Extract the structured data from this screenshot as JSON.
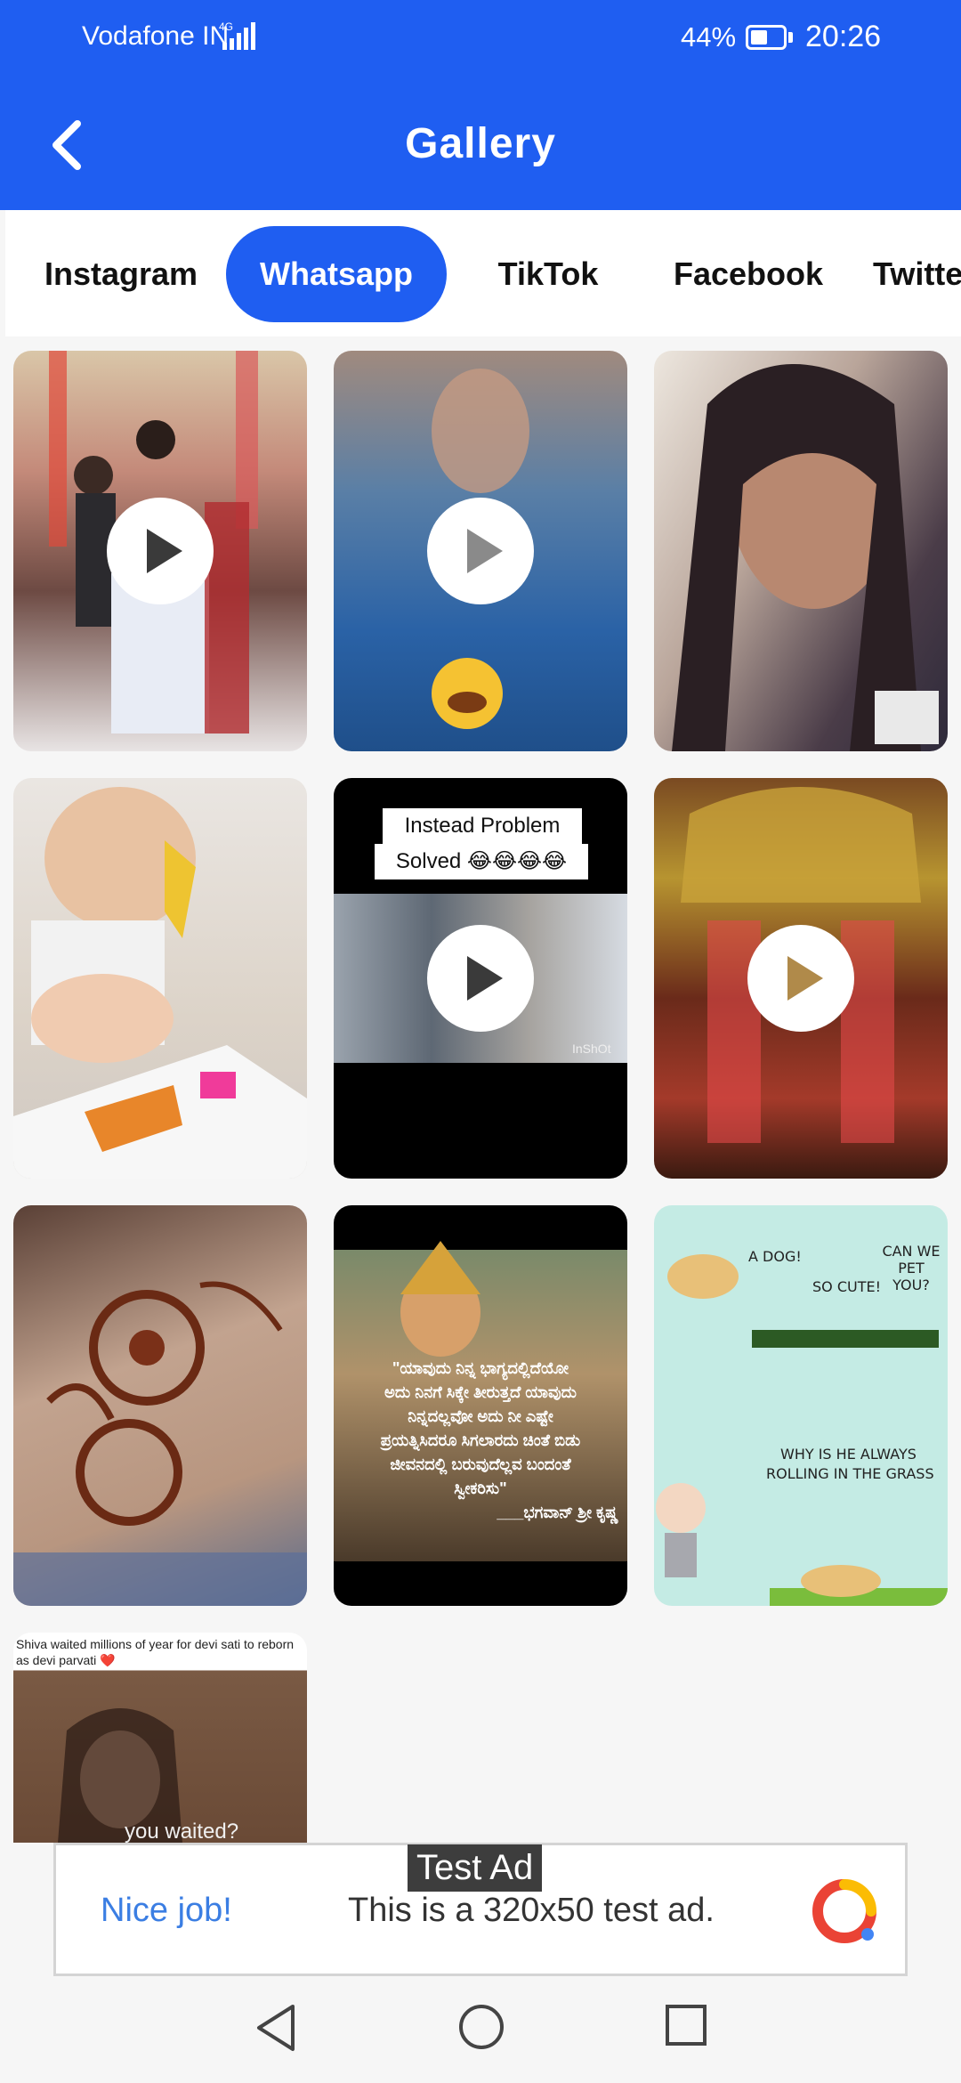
{
  "status_bar": {
    "carrier": "Vodafone IN",
    "network": "4G",
    "battery": "44%",
    "time": "20:26"
  },
  "app_bar": {
    "title": "Gallery",
    "back_icon": "chevron-left-icon"
  },
  "tabs": [
    {
      "label": "Instagram",
      "active": false
    },
    {
      "label": "Whatsapp",
      "active": true
    },
    {
      "label": "TikTok",
      "active": false
    },
    {
      "label": "Facebook",
      "active": false
    },
    {
      "label": "Twitter",
      "active": false
    }
  ],
  "gallery": {
    "items": [
      {
        "kind": "video"
      },
      {
        "kind": "video"
      },
      {
        "kind": "image"
      },
      {
        "kind": "image"
      },
      {
        "kind": "video",
        "caption_line1": "Instead Problem",
        "caption_line2": "Solved 😂😂😂😂",
        "watermark": "InShOt"
      },
      {
        "kind": "video"
      },
      {
        "kind": "image"
      },
      {
        "kind": "image",
        "caption_lines": [
          "\"ಯಾವುದು ನಿನ್ನ ಭಾಗ್ಯದಲ್ಲಿದೆಯೋ",
          "ಅದು ನಿನಗೆ ಸಿಕ್ಕೇ ತೀರುತ್ತದೆ ಯಾವುದು",
          "ನಿನ್ನದಲ್ಲವೋ ಅದು ನೀ ಎಷ್ಟೇ",
          "ಪ್ರಯತ್ನಿಸಿದರೂ ಸಿಗಲಾರದು ಚಿಂತೆ ಬಿಡು",
          "ಜೀವನದಲ್ಲಿ ಬರುವುದೆಲ್ಲವ ಬಂದಂತೆ",
          "ಸ್ವೀಕರಿಸು\"",
          "___ಭಗವಾನ್ ಶ್ರೀ ಕೃಷ್ಣ"
        ]
      },
      {
        "kind": "image",
        "comic_labels": [
          "A DOG!",
          "CAN WE PET YOU?",
          "SO CUTE!",
          "WHY IS HE ALWAYS",
          "ROLLING IN THE GRASS"
        ]
      },
      {
        "kind": "image",
        "caption": "Shiva waited millions of year for devi sati to reborn as devi parvati ❤️",
        "overlay": "you waited?"
      }
    ]
  },
  "ad": {
    "badge": "Test Ad",
    "headline": "Nice job!",
    "text": "This is a 320x50 test ad.",
    "logo_icon": "admob-logo-icon"
  },
  "nav_bar": {
    "back_icon": "nav-back-icon",
    "home_icon": "nav-home-icon",
    "recents_icon": "nav-recents-icon"
  }
}
